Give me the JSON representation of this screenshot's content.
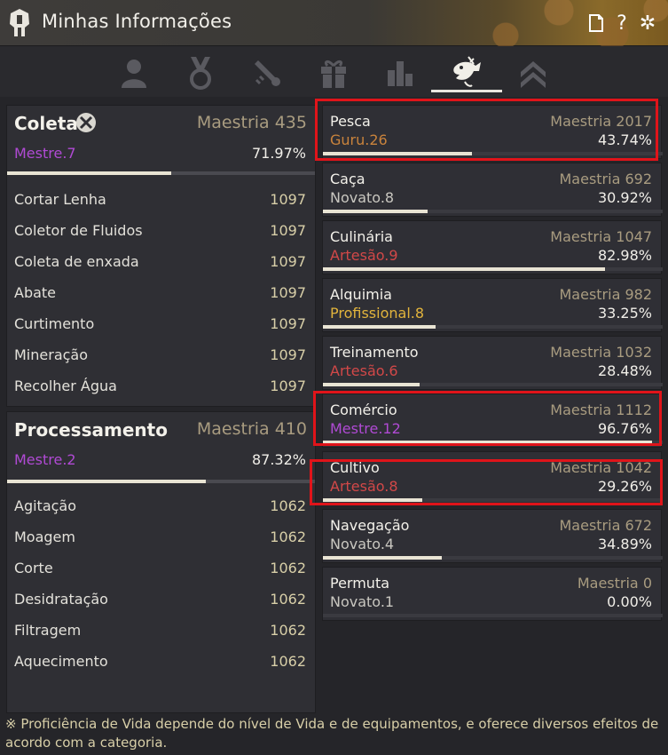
{
  "window": {
    "title": "Minhas Informações",
    "buttons": [
      {
        "name": "page-icon",
        "glyph": "▯"
      },
      {
        "name": "help-icon",
        "glyph": "?"
      },
      {
        "name": "gear-icon",
        "glyph": "✲"
      }
    ]
  },
  "tabs": [
    {
      "name": "profile-icon"
    },
    {
      "name": "medal-icon"
    },
    {
      "name": "scroll-icon"
    },
    {
      "name": "gift-icon"
    },
    {
      "name": "stats-icon"
    },
    {
      "name": "life-skill-icon",
      "active": true
    },
    {
      "name": "rank-up-icon"
    }
  ],
  "coleta": {
    "title": "Coleta",
    "mastery": "Maestria 435",
    "level": "Mestre.7",
    "percent": "71.97%",
    "progress": 0.7197,
    "items": [
      {
        "name": "Cortar Lenha",
        "value": "1097"
      },
      {
        "name": "Coletor de Fluidos",
        "value": "1097"
      },
      {
        "name": "Coleta de enxada",
        "value": "1097"
      },
      {
        "name": "Abate",
        "value": "1097"
      },
      {
        "name": "Curtimento",
        "value": "1097"
      },
      {
        "name": "Mineração",
        "value": "1097"
      },
      {
        "name": "Recolher Água",
        "value": "1097"
      }
    ]
  },
  "processamento": {
    "title": "Processamento",
    "mastery": "Maestria 410",
    "level": "Mestre.2",
    "percent": "87.32%",
    "progress": 0.8732,
    "items": [
      {
        "name": "Agitação",
        "value": "1062"
      },
      {
        "name": "Moagem",
        "value": "1062"
      },
      {
        "name": "Corte",
        "value": "1062"
      },
      {
        "name": "Desidratação",
        "value": "1062"
      },
      {
        "name": "Filtragem",
        "value": "1062"
      },
      {
        "name": "Aquecimento",
        "value": "1062"
      }
    ]
  },
  "skills": [
    {
      "name": "Pesca",
      "mastery": "Maestria 2017",
      "level": "Guru.26",
      "level_color": "#c9833c",
      "percent": "43.74%",
      "progress": 0.4374,
      "highlighted": true
    },
    {
      "name": "Caça",
      "mastery": "Maestria 692",
      "level": "Novato.8",
      "level_color": "#c9c7c0",
      "percent": "30.92%",
      "progress": 0.3092,
      "highlighted": false
    },
    {
      "name": "Culinária",
      "mastery": "Maestria 1047",
      "level": "Artesão.9",
      "level_color": "#d24848",
      "percent": "82.98%",
      "progress": 0.8298,
      "highlighted": false
    },
    {
      "name": "Alquimia",
      "mastery": "Maestria 982",
      "level": "Profissional.8",
      "level_color": "#e2b43c",
      "percent": "33.25%",
      "progress": 0.3325,
      "highlighted": false
    },
    {
      "name": "Treinamento",
      "mastery": "Maestria 1032",
      "level": "Artesão.6",
      "level_color": "#d24848",
      "percent": "28.48%",
      "progress": 0.2848,
      "highlighted": false
    },
    {
      "name": "Comércio",
      "mastery": "Maestria 1112",
      "level": "Mestre.12",
      "level_color": "#b04ad4",
      "percent": "96.76%",
      "progress": 0.9676,
      "highlighted": true
    },
    {
      "name": "Cultivo",
      "mastery": "Maestria 1042",
      "level": "Artesão.8",
      "level_color": "#d24848",
      "percent": "29.26%",
      "progress": 0.2926,
      "highlighted": true
    },
    {
      "name": "Navegação",
      "mastery": "Maestria 672",
      "level": "Novato.4",
      "level_color": "#c9c7c0",
      "percent": "34.89%",
      "progress": 0.3489,
      "highlighted": false
    },
    {
      "name": "Permuta",
      "mastery": "Maestria 0",
      "level": "Novato.1",
      "level_color": "#c9c7c0",
      "percent": "0.00%",
      "progress": 0,
      "highlighted": false
    }
  ],
  "footer_note": "※ Proficiência de Vida depende do nível de Vida e de equipamentos, e oferece diversos efeitos de acordo com a categoria.",
  "colors": {
    "highlight": "#e0141a",
    "mestre": "#b04ad4",
    "bar_fill": "#e9e4d4"
  }
}
